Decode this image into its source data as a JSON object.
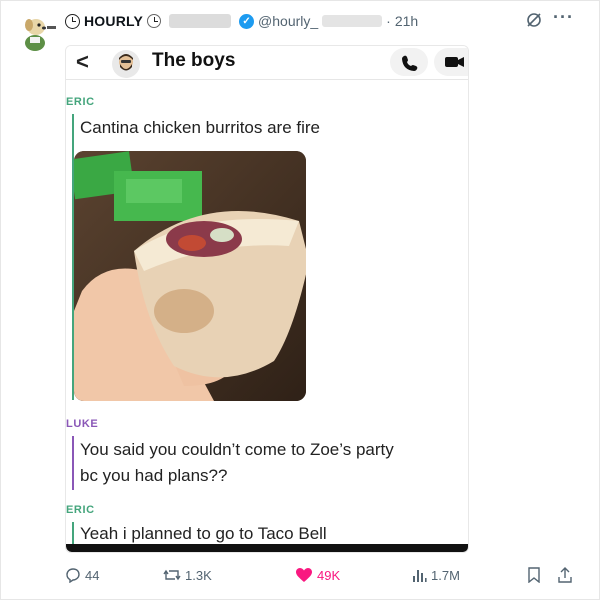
{
  "tweet": {
    "display_name": "HOURLY",
    "handle": "@hourly_",
    "separator": "·",
    "time": "21h",
    "more_label": "···"
  },
  "screenshot": {
    "back_label": "<",
    "group_title": "The boys",
    "messages": [
      {
        "sender": "ERIC",
        "text": "Cantina chicken burritos are fire",
        "color": "#44a57c"
      },
      {
        "sender": "LUKE",
        "text_lines": [
          "You said you couldn’t come to Zoe’s party",
          "bc you had plans??"
        ],
        "color": "#8a57b7"
      },
      {
        "sender": "ERIC",
        "text": "Yeah i planned to go to Taco Bell",
        "color": "#44a57c"
      }
    ]
  },
  "actions": {
    "replies": "44",
    "retweets": "1.3K",
    "likes": "49K",
    "views": "1.7M"
  },
  "colors": {
    "like": "#f91880",
    "verified": "#1d9bf0",
    "muted": "#536471"
  },
  "icons": [
    "clock-icon",
    "verified-badge-icon",
    "grok-icon",
    "more-icon",
    "back-icon",
    "phone-icon",
    "video-icon",
    "reply-icon",
    "retweet-icon",
    "like-icon",
    "views-icon",
    "bookmark-icon",
    "share-icon"
  ]
}
